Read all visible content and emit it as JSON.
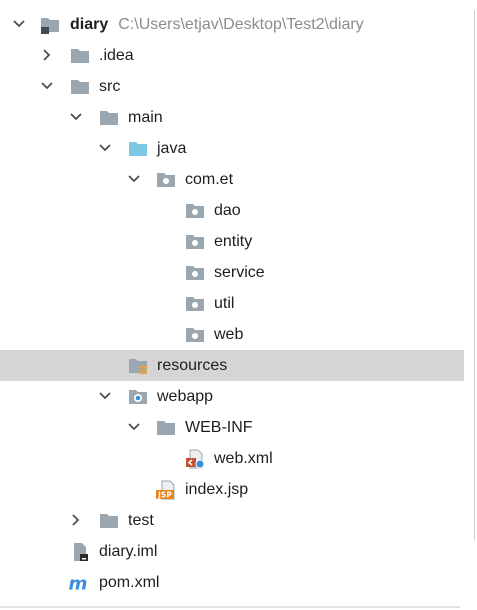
{
  "project": {
    "name": "diary",
    "path": "C:\\Users\\etjav\\Desktop\\Test2\\diary"
  },
  "tree": {
    "idea": ".idea",
    "src": "src",
    "main": "main",
    "java": "java",
    "package": "com.et",
    "dao": "dao",
    "entity": "entity",
    "service": "service",
    "util": "util",
    "web": "web",
    "resources": "resources",
    "webapp": "webapp",
    "webinf": "WEB-INF",
    "webxml": "web.xml",
    "indexjsp": "index.jsp",
    "test": "test",
    "diaryiml": "diary.iml",
    "pomxml": "pom.xml"
  },
  "icons": {
    "jsp_badge": "JSP",
    "maven_badge": "m"
  },
  "selected_item": "resources",
  "colors": {
    "folder": "#9aa7b0",
    "source_folder": "#7ec8e3",
    "selection": "#d5d5d5",
    "chevron": "#4f4f4f",
    "path_text": "#8c8c8c",
    "jsp_badge": "#e8821a",
    "maven": "#3c8ddb"
  }
}
